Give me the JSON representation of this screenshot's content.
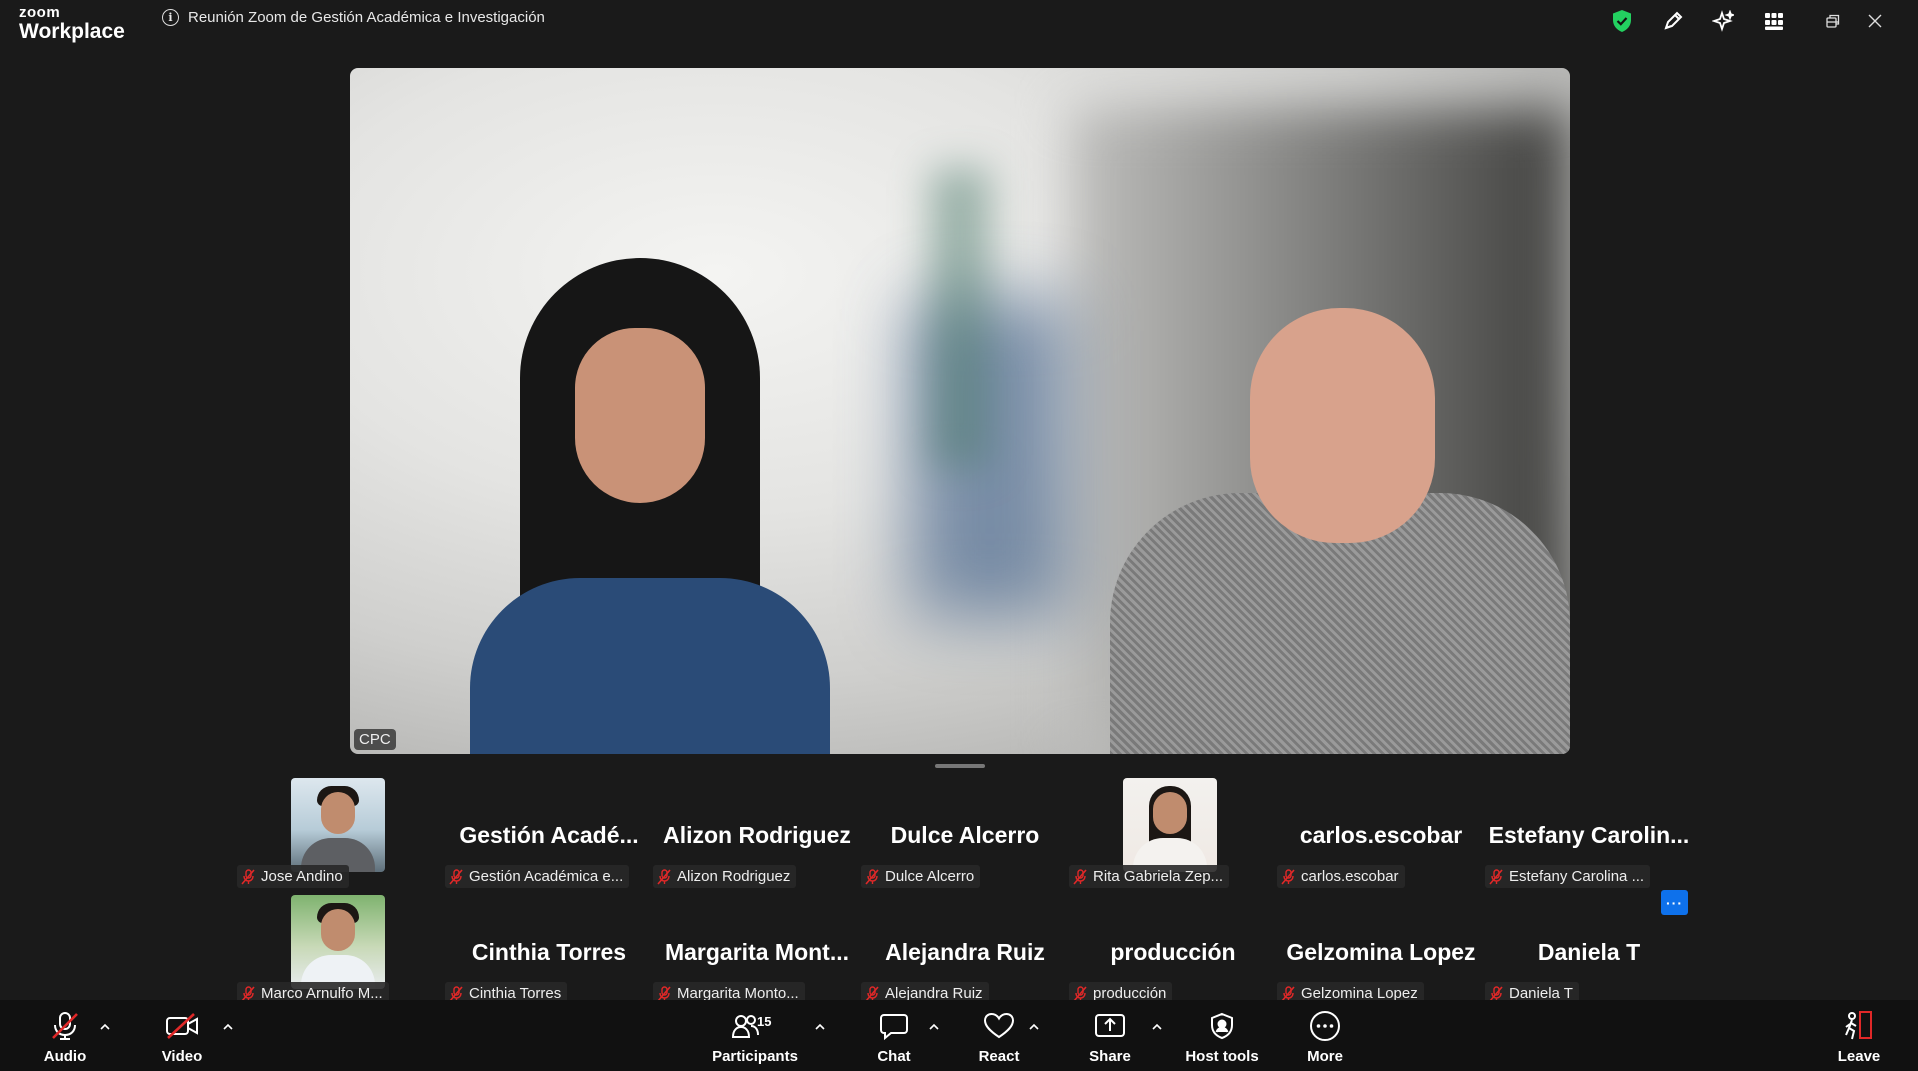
{
  "app": {
    "brand_top": "zoom",
    "brand_bottom": "Workplace"
  },
  "meeting": {
    "title": "Reunión Zoom de Gestión Académica e Investigación"
  },
  "main_video": {
    "label": "CPC"
  },
  "gallery": {
    "row1": [
      {
        "big": "",
        "tag": "Jose Andino",
        "has_photo": true
      },
      {
        "big": "Gestión  Acadé...",
        "tag": "Gestión Académica e..."
      },
      {
        "big": "Alizon Rodriguez",
        "tag": "Alizon Rodriguez"
      },
      {
        "big": "Dulce Alcerro",
        "tag": "Dulce Alcerro"
      },
      {
        "big": "",
        "tag": "Rita Gabriela Zep...",
        "has_photo": true
      },
      {
        "big": "carlos.escobar",
        "tag": "carlos.escobar"
      },
      {
        "big": "Estefany  Carolin...",
        "tag": "Estefany Carolina ..."
      }
    ],
    "row2": [
      {
        "big": "",
        "tag": "Marco Arnulfo M...",
        "has_photo": true
      },
      {
        "big": "Cinthia Torres",
        "tag": "Cinthia Torres"
      },
      {
        "big": "Margarita  Mont...",
        "tag": "Margarita Monto..."
      },
      {
        "big": "Alejandra Ruiz",
        "tag": "Alejandra Ruiz"
      },
      {
        "big": "producción",
        "tag": "producción"
      },
      {
        "big": "Gelzomina Lopez",
        "tag": "Gelzomina Lopez"
      },
      {
        "big": "Daniela T",
        "tag": "Daniela T"
      }
    ],
    "more_label": "···"
  },
  "toolbar": {
    "audio": "Audio",
    "video": "Video",
    "participants": "Participants",
    "participants_count": "15",
    "chat": "Chat",
    "react": "React",
    "share": "Share",
    "host_tools": "Host tools",
    "more": "More",
    "leave": "Leave"
  },
  "colors": {
    "accent": "#0e71eb",
    "mute_red": "#e02828",
    "shield_green": "#23d160",
    "leave_red": "#e02828"
  }
}
